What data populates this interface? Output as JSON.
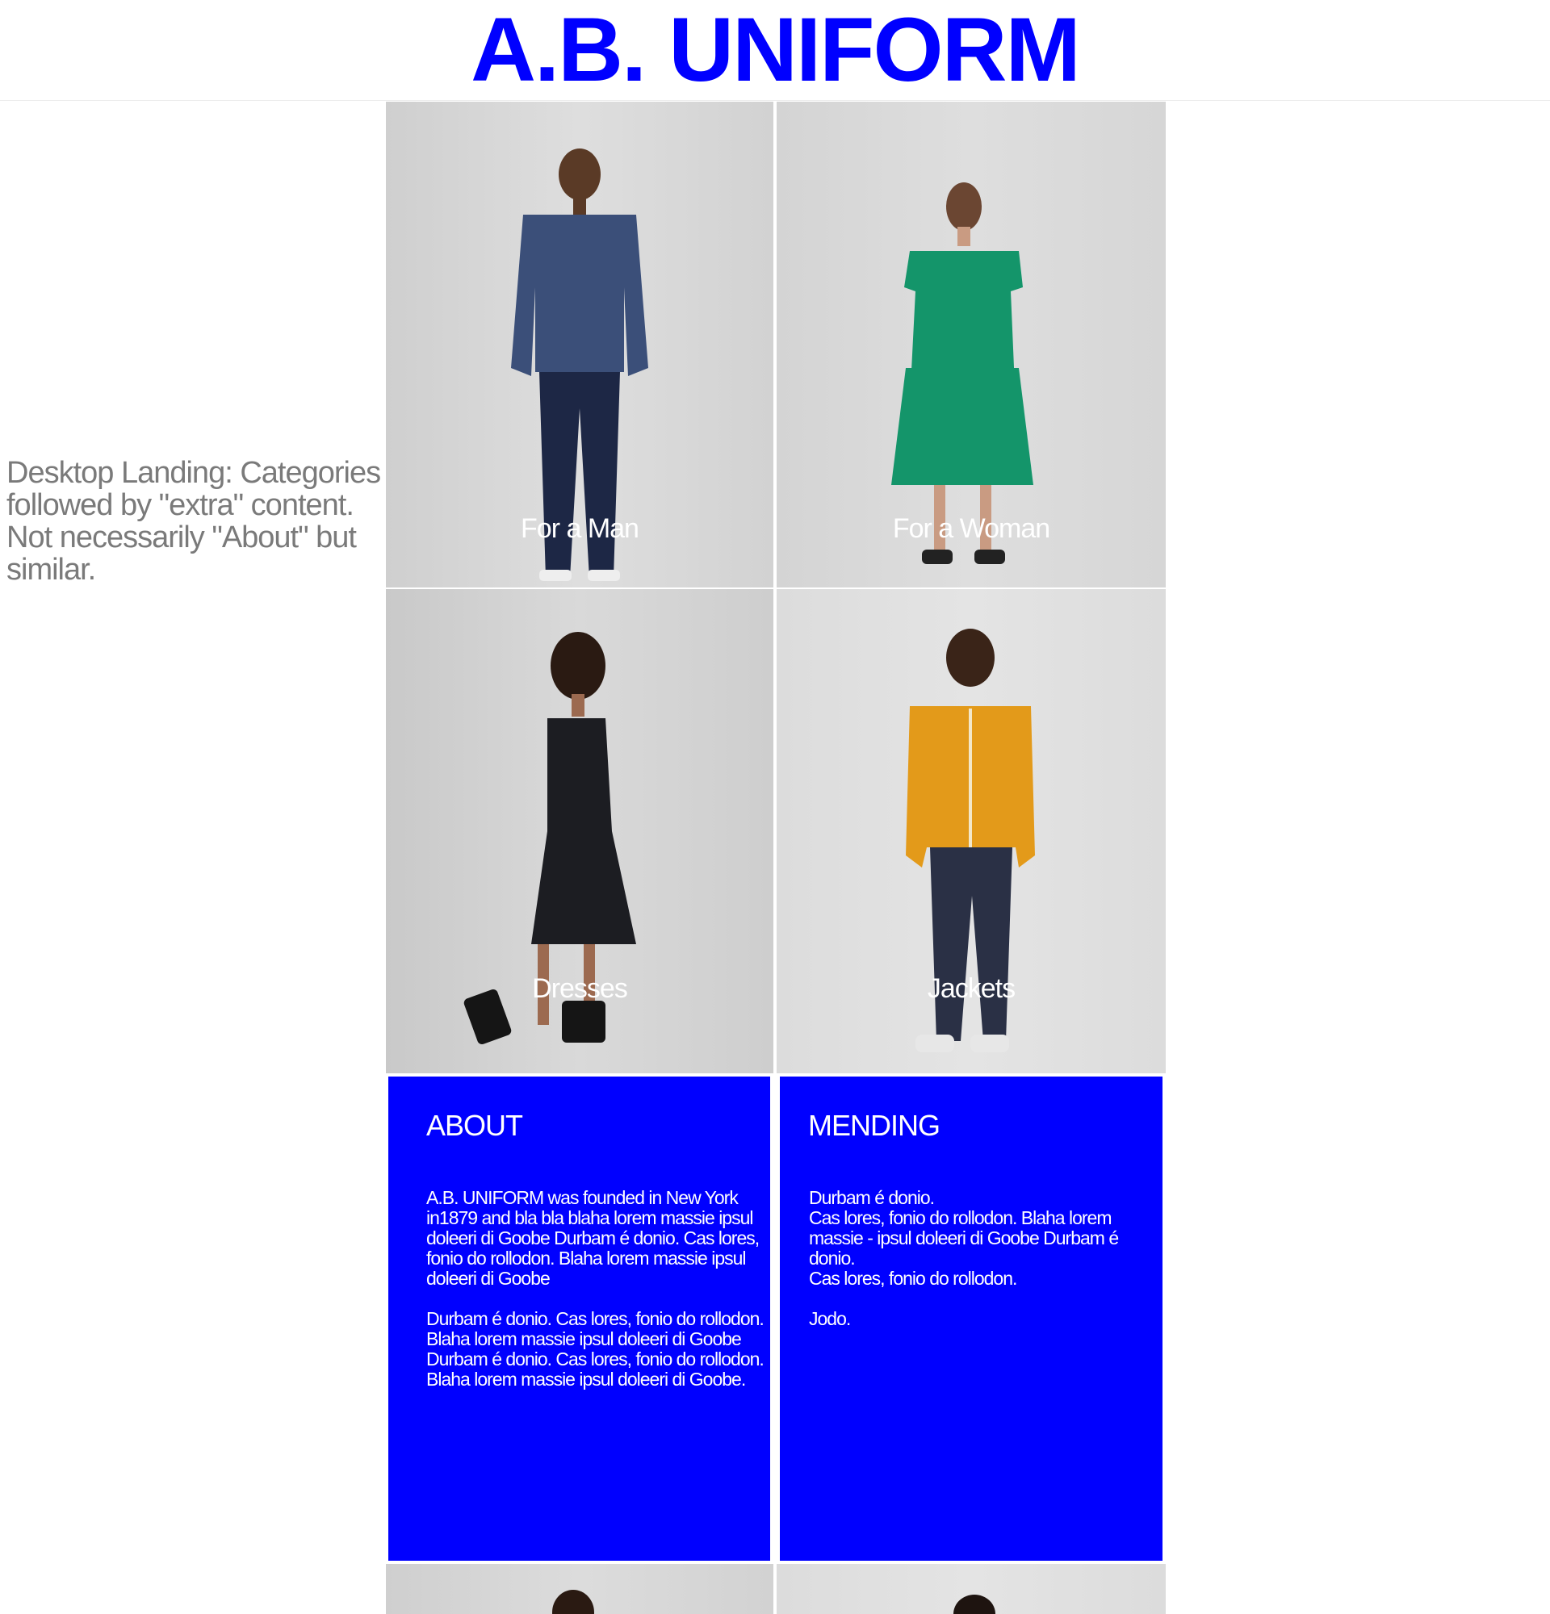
{
  "header": {
    "logo": "A.B. UNIFORM"
  },
  "annotation": "Desktop Landing: Categories followed by \"extra\" content. Not necessarily \"About\" but similar.",
  "categories": [
    {
      "label": "For a Man"
    },
    {
      "label": "For a Woman"
    },
    {
      "label": "Dresses"
    },
    {
      "label": "Jackets"
    }
  ],
  "about": {
    "title": "ABOUT",
    "body": "A.B. UNIFORM was founded in New York in1879 and bla bla blaha lorem massie ipsul doleeri di Goobe Durbam é donio. Cas lores, fonio do rollodon. Blaha lorem massie ipsul doleeri di Goobe\n\nDurbam é donio. Cas lores, fonio do rollodon. Blaha lorem massie ipsul doleeri di Goobe Durbam é donio. Cas lores, fonio do rollodon. Blaha lorem massie ipsul doleeri di Goobe."
  },
  "mending": {
    "title": "MENDING",
    "body": "Durbam é donio.\nCas lores, fonio do rollodon. Blaha lorem massie - ipsul doleeri di Goobe Durbam é donio.\nCas lores, fonio do rollodon.\n\nJodo."
  },
  "colors": {
    "brand": "#0000ff",
    "jacket_denim": "#3b4f79",
    "dress_green": "#14956a",
    "dress_black": "#1c1d22",
    "jacket_yellow": "#e39a1a"
  }
}
